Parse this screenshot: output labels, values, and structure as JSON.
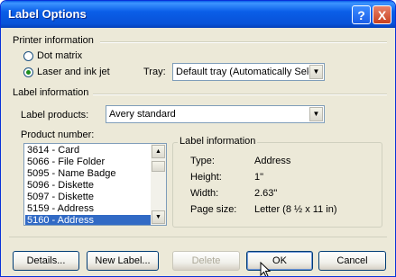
{
  "window": {
    "title": "Label Options"
  },
  "printer_info": {
    "heading": "Printer information",
    "dot_matrix": "Dot matrix",
    "laser": "Laser and ink jet",
    "tray_label": "Tray:",
    "tray_value": "Default tray (Automatically Sele"
  },
  "label_info": {
    "heading": "Label information",
    "products_label": "Label products:",
    "products_value": "Avery standard",
    "product_number_label": "Product number:",
    "products": [
      "3614 - Card",
      "5066 - File Folder",
      "5095 - Name Badge",
      "5096 - Diskette",
      "5097 - Diskette",
      "5159 - Address",
      "5160 - Address"
    ],
    "selected_index": 6
  },
  "details_box": {
    "heading": "Label information",
    "rows": [
      {
        "key": "Type:",
        "value": "Address"
      },
      {
        "key": "Height:",
        "value": "1\""
      },
      {
        "key": "Width:",
        "value": "2.63\""
      },
      {
        "key": "Page size:",
        "value": "Letter (8 ½ x 11 in)"
      }
    ]
  },
  "buttons": {
    "details": "Details...",
    "new_label": "New Label...",
    "delete": "Delete",
    "ok": "OK",
    "cancel": "Cancel"
  },
  "title_buttons": {
    "help": "?",
    "close": "X"
  }
}
